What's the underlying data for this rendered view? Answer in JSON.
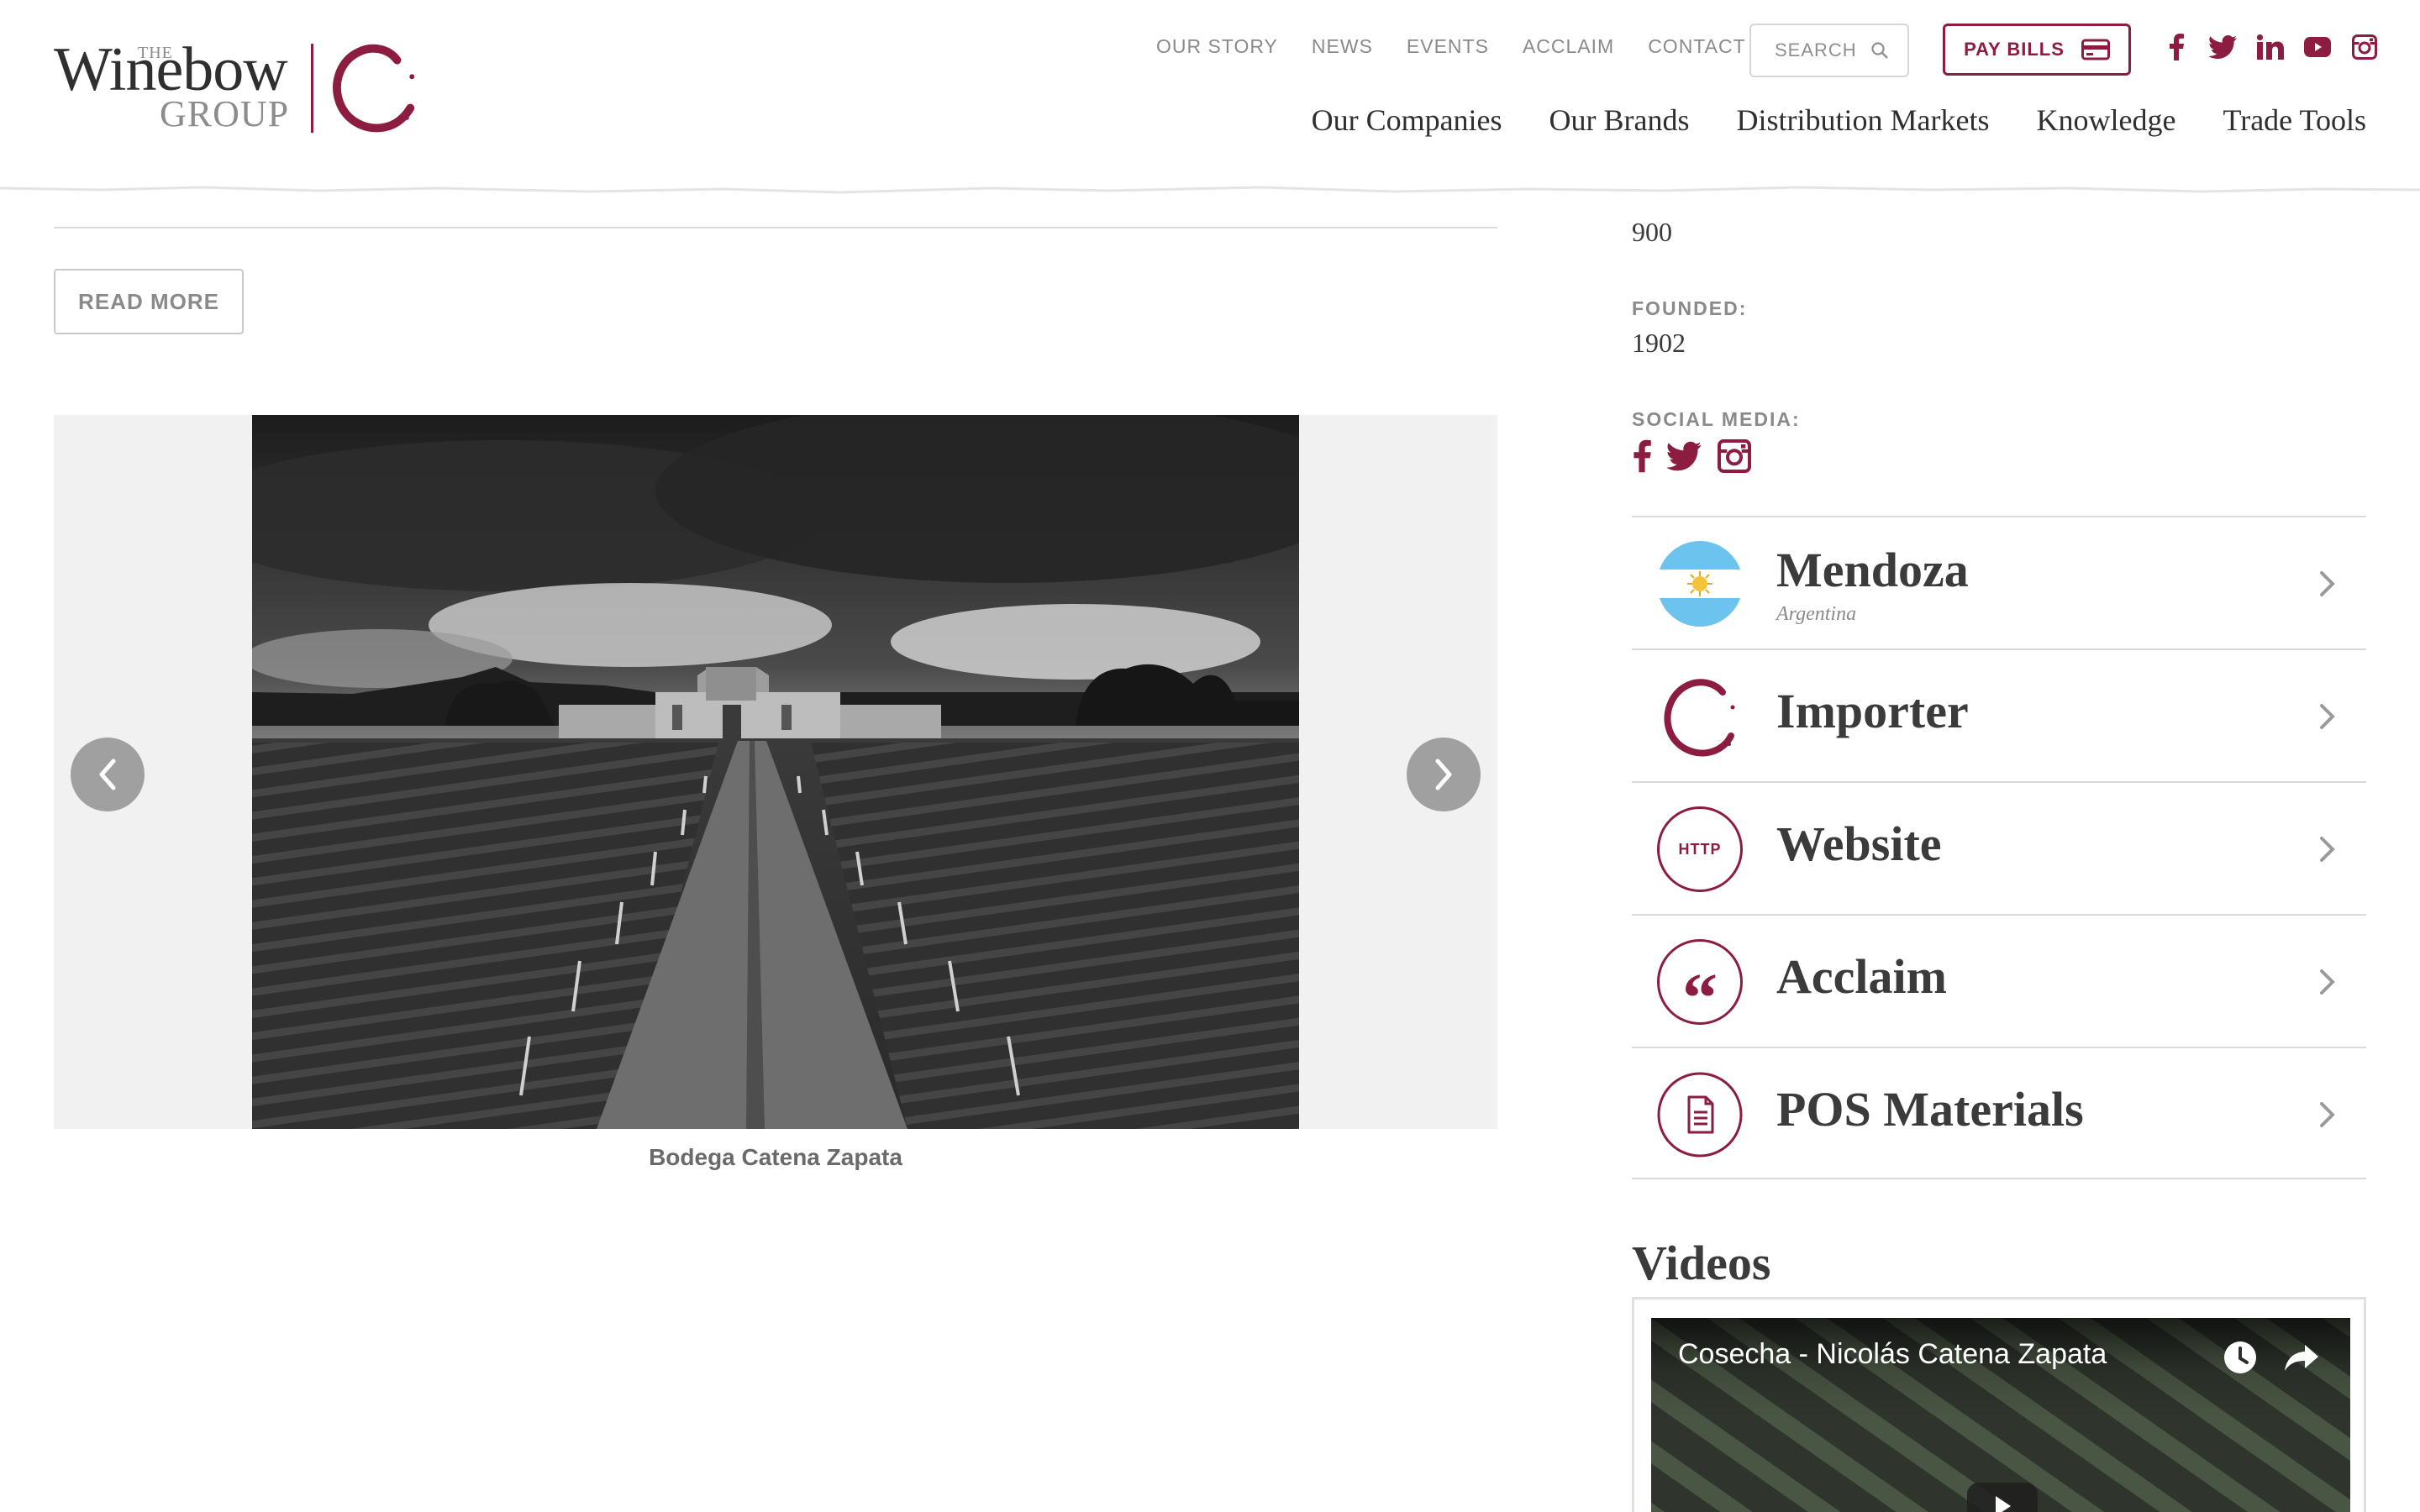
{
  "header": {
    "util_nav": [
      "OUR STORY",
      "NEWS",
      "EVENTS",
      "ACCLAIM",
      "CONTACT"
    ],
    "search_label": "SEARCH",
    "pay_bills_label": "PAY BILLS",
    "main_nav": [
      "Our Companies",
      "Our Brands",
      "Distribution Markets",
      "Knowledge",
      "Trade Tools"
    ],
    "logo": {
      "the": "THE",
      "winebow": "Winebow",
      "group": "GROUP"
    },
    "social_icons": [
      "facebook-icon",
      "twitter-icon",
      "linkedin-icon",
      "youtube-icon",
      "instagram-icon"
    ]
  },
  "main": {
    "read_more_label": "READ MORE",
    "gallery": {
      "caption": "Bodega Catena Zapata"
    }
  },
  "sidebar": {
    "top_value": "900",
    "founded_label": "FOUNDED:",
    "founded_value": "1902",
    "social_label": "SOCIAL MEDIA:",
    "social_icons": [
      "facebook-icon",
      "twitter-icon",
      "instagram-icon"
    ],
    "links": [
      {
        "title": "Mendoza",
        "subtitle": "Argentina",
        "icon": "argentina-flag-icon"
      },
      {
        "title": "Importer",
        "subtitle": "",
        "icon": "winebow-c-icon"
      },
      {
        "title": "Website",
        "subtitle": "",
        "icon": "http-icon",
        "icon_text": "HTTP"
      },
      {
        "title": "Acclaim",
        "subtitle": "",
        "icon": "quote-icon",
        "icon_text": "“"
      },
      {
        "title": "POS Materials",
        "subtitle": "",
        "icon": "document-icon"
      }
    ],
    "videos_title": "Videos",
    "video": {
      "title": "Cosecha - Nicolás Catena Zapata"
    }
  },
  "colors": {
    "brand": "#8c1d40",
    "text": "#3b3b3b",
    "muted": "#8a8a8a"
  }
}
